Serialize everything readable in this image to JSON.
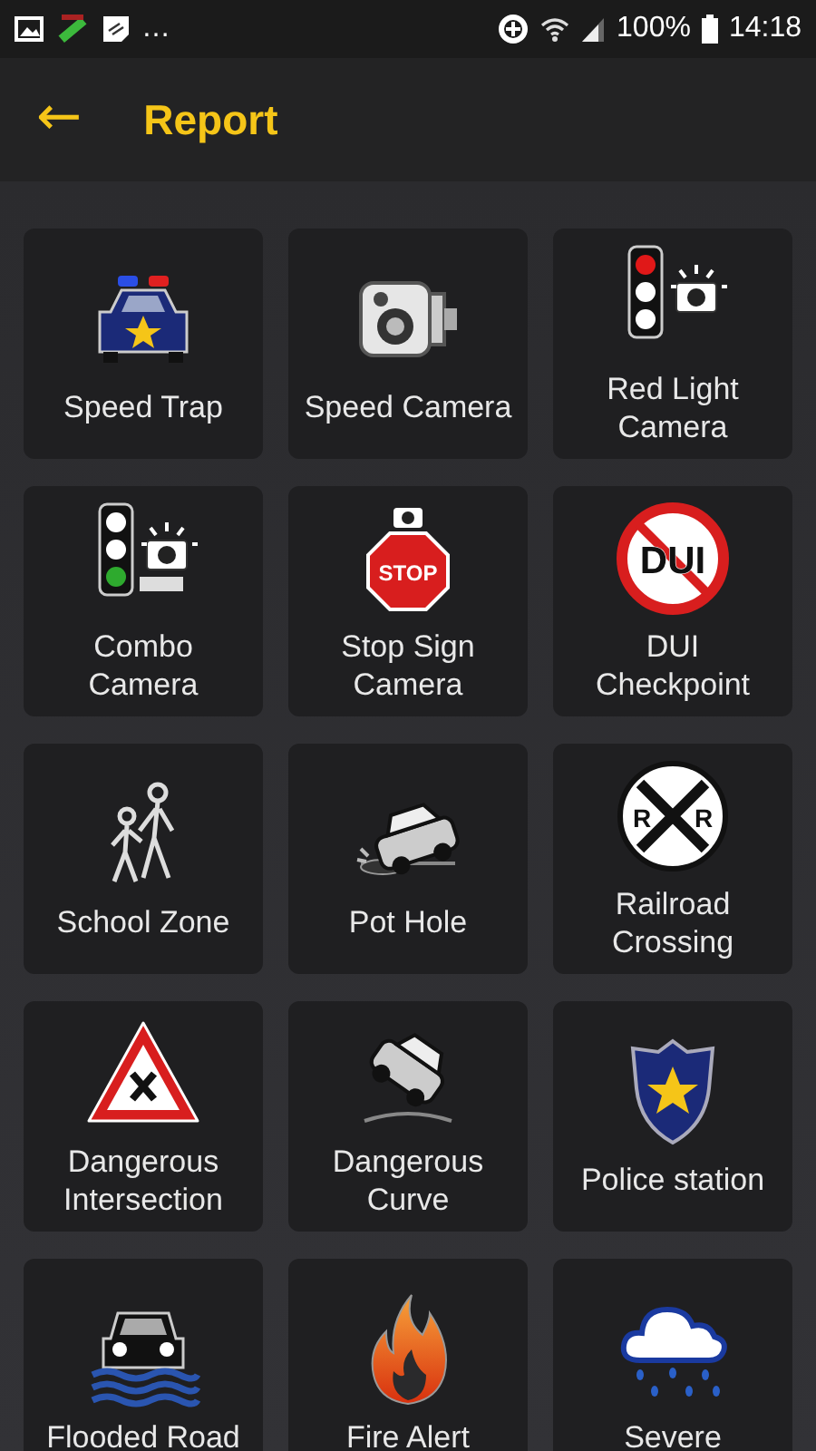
{
  "status_bar": {
    "overflow": "…",
    "battery_percent": "100%",
    "time": "14:18"
  },
  "header": {
    "back": "←",
    "title": "Report"
  },
  "options": [
    {
      "kind": "police-car",
      "label": "Speed Trap"
    },
    {
      "kind": "speed-camera",
      "label": "Speed Camera"
    },
    {
      "kind": "red-light",
      "label": "Red Light Camera"
    },
    {
      "kind": "combo",
      "label": "Combo\nCamera"
    },
    {
      "kind": "stop-sign",
      "label": "Stop Sign Camera",
      "sign_text": [
        "STOP"
      ]
    },
    {
      "kind": "dui",
      "label": "DUI\nCheckpoint",
      "sign_text": [
        "DUI"
      ]
    },
    {
      "kind": "school",
      "label": "School Zone"
    },
    {
      "kind": "pothole",
      "label": "Pot Hole"
    },
    {
      "kind": "railroad",
      "label": "Railroad Crossing",
      "sign_text": [
        "R",
        "R"
      ]
    },
    {
      "kind": "intersection",
      "label": "Dangerous Intersection"
    },
    {
      "kind": "curve",
      "label": "Dangerous Curve"
    },
    {
      "kind": "police-station",
      "label": "Police station"
    },
    {
      "kind": "flood",
      "label": "Flooded Road"
    },
    {
      "kind": "fire",
      "label": "Fire Alert"
    },
    {
      "kind": "weather",
      "label": "Severe"
    }
  ]
}
